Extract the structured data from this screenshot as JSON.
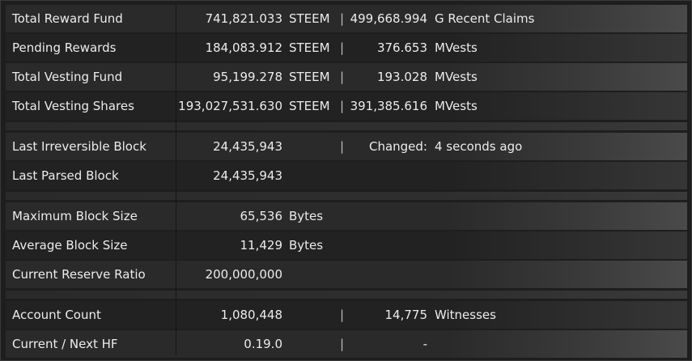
{
  "rows": {
    "total_reward_fund": {
      "label": "Total Reward Fund",
      "value": "741,821.033",
      "unit": "STEEM",
      "sep": "|",
      "value2": "499,668.994",
      "unit2": "G  Recent Claims"
    },
    "pending_rewards": {
      "label": "Pending Rewards",
      "value": "184,083.912",
      "unit": "STEEM",
      "sep": "|",
      "value2": "376.653",
      "unit2": "MVests"
    },
    "total_vesting_fund": {
      "label": "Total Vesting Fund",
      "value": "95,199.278",
      "unit": "STEEM",
      "sep": "|",
      "value2": "193.028",
      "unit2": "MVests"
    },
    "total_vesting_shares": {
      "label": "Total Vesting Shares",
      "value": "193,027,531.630",
      "unit": "STEEM",
      "sep": "|",
      "value2": "391,385.616",
      "unit2": "MVests"
    },
    "last_irreversible_block": {
      "label": "Last Irreversible Block",
      "value": "24,435,943",
      "sep": "|",
      "value2": "Changed:",
      "unit2": "4 seconds ago"
    },
    "last_parsed_block": {
      "label": "Last Parsed Block",
      "value": "24,435,943"
    },
    "maximum_block_size": {
      "label": "Maximum Block Size",
      "value": "65,536",
      "unit": "Bytes"
    },
    "average_block_size": {
      "label": "Average Block Size",
      "value": "11,429",
      "unit": "Bytes"
    },
    "current_reserve_ratio": {
      "label": "Current Reserve Ratio",
      "value": "200,000,000"
    },
    "account_count": {
      "label": "Account Count",
      "value": "1,080,448",
      "sep": "|",
      "value2": "14,775",
      "unit2": "Witnesses"
    },
    "current_next_hf": {
      "label": "Current / Next HF",
      "value": "0.19.0",
      "sep": "|",
      "value2": "-"
    }
  }
}
